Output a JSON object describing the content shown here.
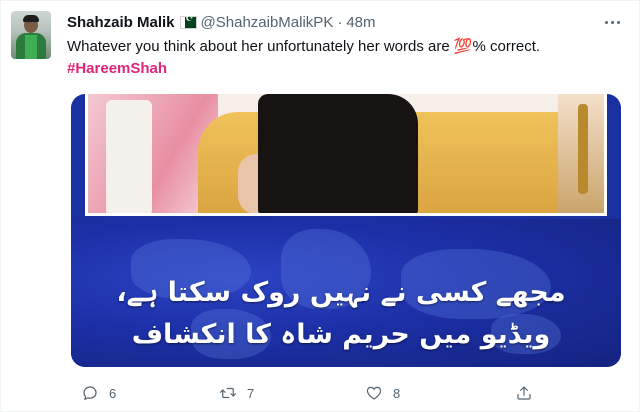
{
  "tweet": {
    "display_name": "Shahzaib Malik",
    "handle": "@ShahzaibMalikPK",
    "separator": "·",
    "time": "48m",
    "text": "Whatever you think about her unfortunately her words are 💯% correct.",
    "hashtag": "#HareemShah",
    "media_caption_line1": "مجھے کسی نے نہیں روک سکتا ہے،",
    "media_caption_line2": "ویڈیو میں حریم شاہ کا انکشاف"
  },
  "actions": {
    "reply_count": "6",
    "retweet_count": "7",
    "like_count": "8",
    "share_count": ""
  },
  "icons": {
    "more": "more-dots-icon",
    "reply": "reply-icon",
    "retweet": "retweet-icon",
    "like": "heart-icon",
    "share": "share-icon",
    "flag": "pakistan-flag-icon"
  },
  "colors": {
    "hashtag": "#e0267a",
    "secondary_text": "#536471",
    "media_background": "#1a2fa0"
  }
}
